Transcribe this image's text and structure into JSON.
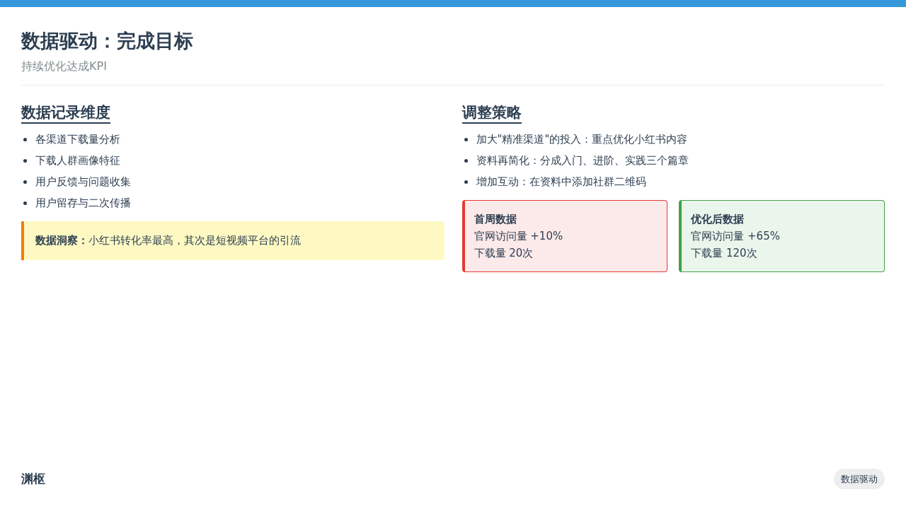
{
  "header": {
    "title": "数据驱动：完成目标",
    "subtitle": "持续优化达成KPI"
  },
  "left": {
    "heading": "数据记录维度",
    "items": [
      "各渠道下载量分析",
      "下载人群画像特征",
      "用户反馈与问题收集",
      "用户留存与二次传播"
    ],
    "insight": "**数据洞察：**小红书转化率最高，其次是短视频平台的引流"
  },
  "right": {
    "heading": "调整策略",
    "items": [
      "加大\"精准渠道\"的投入：重点优化小红书内容",
      "资料再简化：分成入门、进阶、实践三个篇章",
      "增加互动：在资料中添加社群二维码"
    ],
    "cards": [
      {
        "title": "首周数据",
        "lines": [
          "官网访问量 +10%",
          "下载量 20次"
        ],
        "color": "#e53935"
      },
      {
        "title": "优化后数据",
        "lines": [
          "官网访问量 +65%",
          "下载量 120次"
        ],
        "color": "#43a047"
      }
    ]
  },
  "footer": {
    "brand": "渊枢",
    "tag": "数据驱动"
  }
}
